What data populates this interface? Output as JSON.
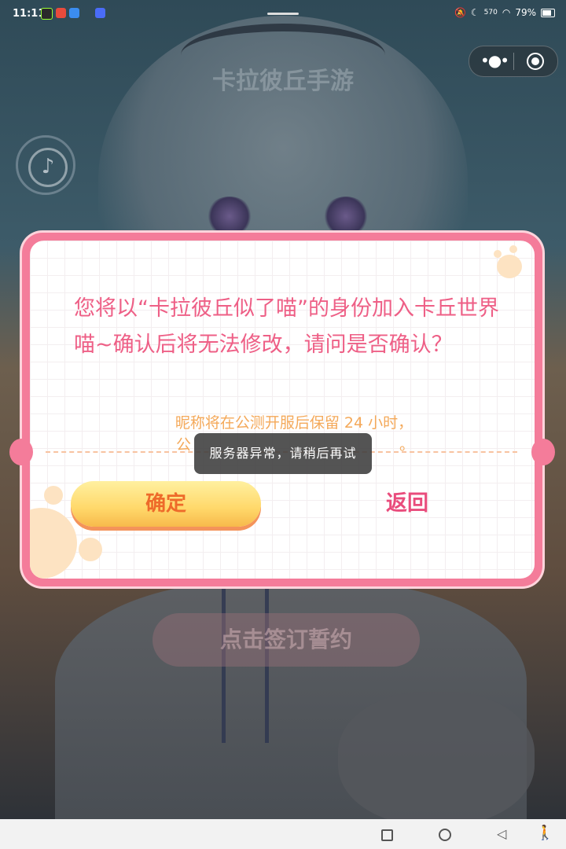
{
  "status_bar": {
    "time": "11:11",
    "network_speed": "570",
    "battery": "79%"
  },
  "page": {
    "title": "卡拉彼丘手游",
    "sign_button": "点击签订誓约"
  },
  "dialog": {
    "message": "您将以“卡拉彼丘似了喵”的身份加入卡丘世界喵~确认后将无法修改，请问是否确认？",
    "note_line1": "昵称将在公测开服后保留 24 小时，",
    "note_line2_start": "公",
    "note_line2_end": "。",
    "confirm_label": "确定",
    "back_label": "返回"
  },
  "toast": {
    "text": "服务器异常，请稍后再试"
  },
  "colors": {
    "dialog_border": "#f47c9a",
    "message_text": "#ee5f86",
    "note_text": "#f4a95a",
    "confirm_bg": "#ffd86a",
    "back_text": "#e94c7c"
  },
  "icons": {
    "music": "music-note-icon",
    "more": "more-dots-icon",
    "close": "target-circle-icon"
  }
}
